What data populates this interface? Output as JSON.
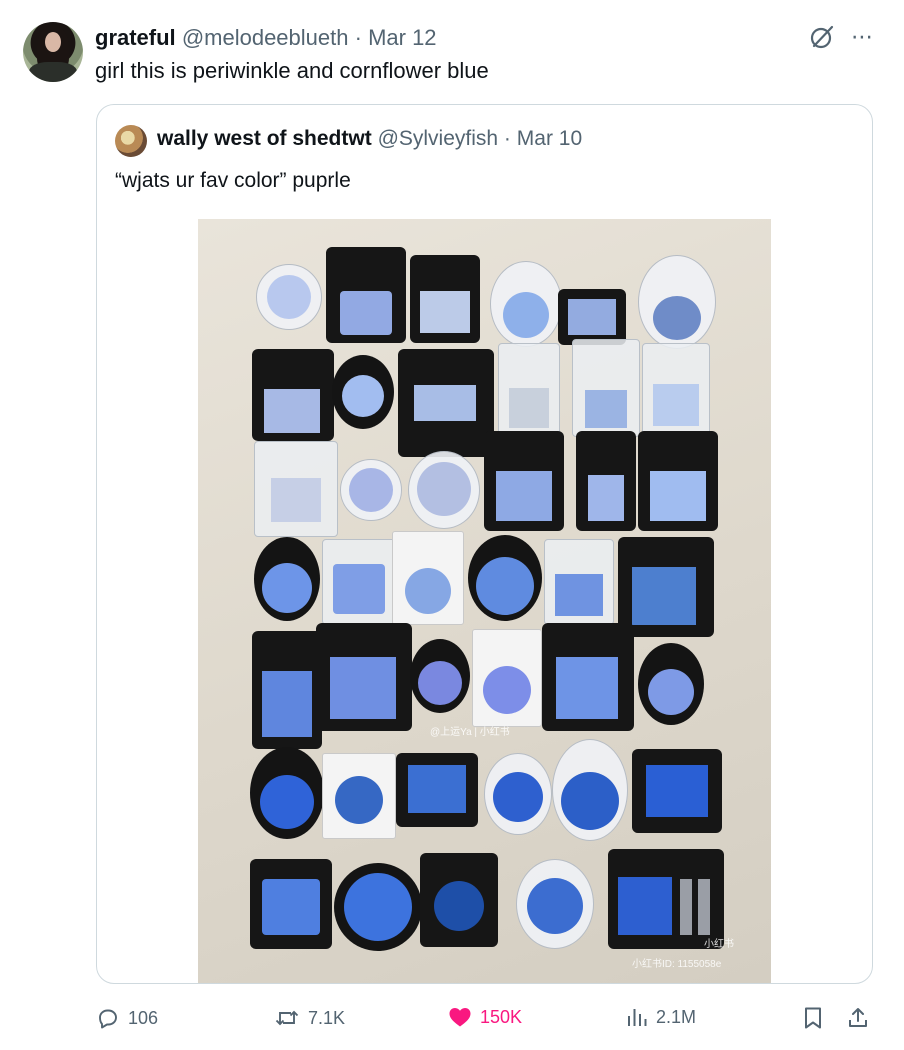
{
  "tweet": {
    "author_name": "grateful",
    "author_handle": "@melodeeblueth",
    "separator": "·",
    "date": "Mar 12",
    "text": "girl this is periwinkle and cornflower blue"
  },
  "quote": {
    "author_name": "wally west of shedtwt",
    "author_handle": "@Sylvieyfish",
    "separator": "·",
    "date": "Mar 10",
    "text": "“wjats ur fav color” puprle",
    "image_watermark_center": "@上运Ya | 小红书",
    "image_watermark_corner": "小红书",
    "image_watermark_id": "小红书ID: 1155058e"
  },
  "actions": {
    "replies": "106",
    "reposts": "7.1K",
    "likes": "150K",
    "views": "2.1M"
  },
  "icons": [
    "grok-icon",
    "more-icon",
    "reply-icon",
    "repost-icon",
    "like-icon",
    "views-icon",
    "bookmark-icon",
    "share-icon"
  ],
  "colors": {
    "like": "#f91880",
    "muted": "#536471",
    "text": "#0f1419",
    "border": "#cfd9de"
  }
}
